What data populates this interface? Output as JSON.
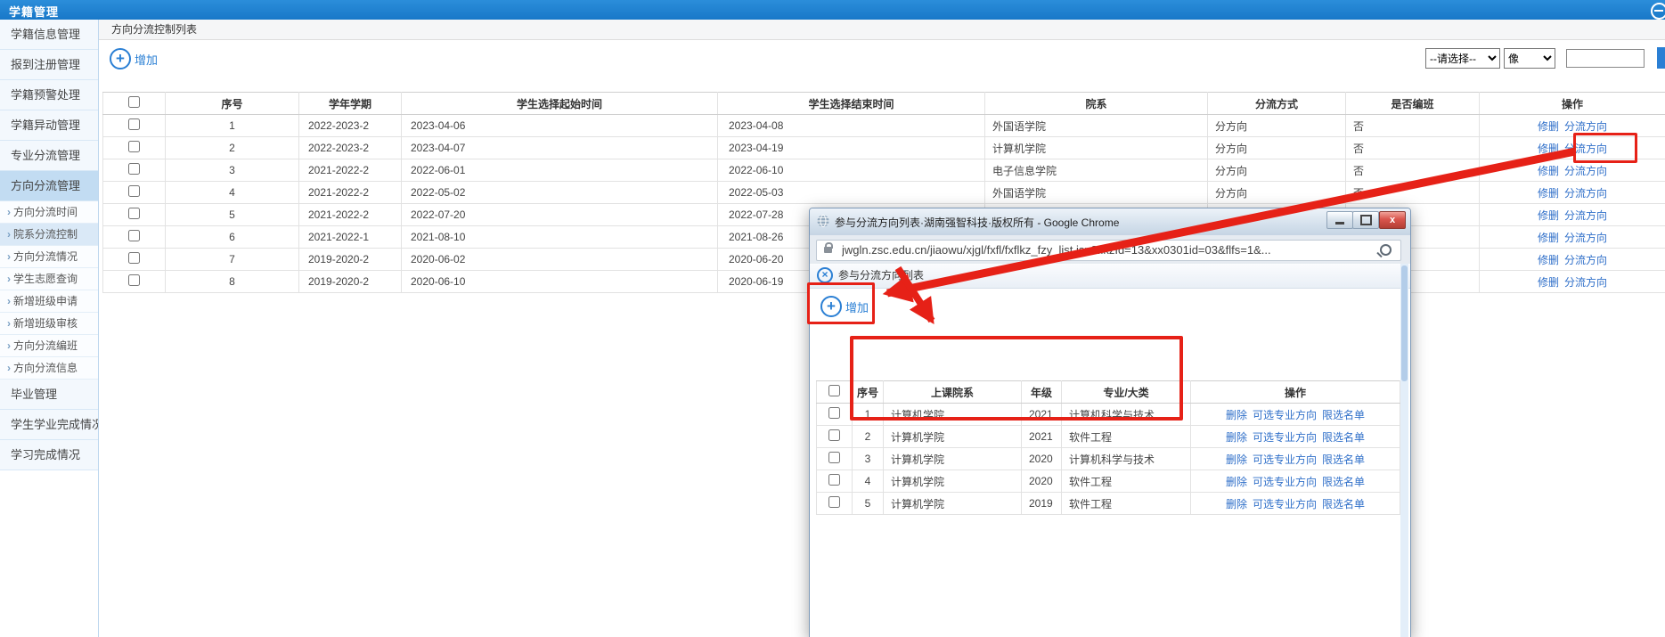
{
  "topbar": {
    "title": "学籍管理"
  },
  "sidebar": {
    "items": [
      {
        "label": "学籍信息管理",
        "type": "main",
        "active": false
      },
      {
        "label": "报到注册管理",
        "type": "main",
        "active": false
      },
      {
        "label": "学籍预警处理",
        "type": "main",
        "active": false
      },
      {
        "label": "学籍异动管理",
        "type": "main",
        "active": false
      },
      {
        "label": "专业分流管理",
        "type": "main",
        "active": false
      },
      {
        "label": "方向分流管理",
        "type": "main",
        "active": true
      },
      {
        "label": "方向分流时间",
        "type": "sub",
        "active": false
      },
      {
        "label": "院系分流控制",
        "type": "sub",
        "active": true
      },
      {
        "label": "方向分流情况",
        "type": "sub",
        "active": false
      },
      {
        "label": "学生志愿查询",
        "type": "sub",
        "active": false
      },
      {
        "label": "新增班级申请",
        "type": "sub",
        "active": false
      },
      {
        "label": "新增班级审核",
        "type": "sub",
        "active": false
      },
      {
        "label": "方向分流编班",
        "type": "sub",
        "active": false
      },
      {
        "label": "方向分流信息",
        "type": "sub",
        "active": false
      },
      {
        "label": "毕业管理",
        "type": "main",
        "active": false
      },
      {
        "label": "学生学业完成情况",
        "type": "main",
        "active": false
      },
      {
        "label": "学习完成情况",
        "type": "main",
        "active": false
      }
    ]
  },
  "content": {
    "page_title": "方向分流控制列表",
    "add_button": "增加",
    "filter": {
      "category_select": "--请选择--",
      "match_select": "像",
      "keyword_value": ""
    },
    "table": {
      "headers": [
        "序号",
        "学年学期",
        "学生选择起始时间",
        "学生选择结束时间",
        "院系",
        "分流方式",
        "是否编班",
        "操作"
      ],
      "row_actions": [
        "修删",
        "分流方向"
      ],
      "rows": [
        {
          "seq": "1",
          "term": "2022-2023-2",
          "start": "2023-04-06",
          "end": "2023-04-08",
          "dept": "外国语学院",
          "mode": "分方向",
          "classed": "否"
        },
        {
          "seq": "2",
          "term": "2022-2023-2",
          "start": "2023-04-07",
          "end": "2023-04-19",
          "dept": "计算机学院",
          "mode": "分方向",
          "classed": "否"
        },
        {
          "seq": "3",
          "term": "2021-2022-2",
          "start": "2022-06-01",
          "end": "2022-06-10",
          "dept": "电子信息学院",
          "mode": "分方向",
          "classed": "否"
        },
        {
          "seq": "4",
          "term": "2021-2022-2",
          "start": "2022-05-02",
          "end": "2022-05-03",
          "dept": "外国语学院",
          "mode": "分方向",
          "classed": "否"
        },
        {
          "seq": "5",
          "term": "2021-2022-2",
          "start": "2022-07-20",
          "end": "2022-07-28",
          "dept": "",
          "mode": "",
          "classed": ""
        },
        {
          "seq": "6",
          "term": "2021-2022-1",
          "start": "2021-08-10",
          "end": "2021-08-26",
          "dept": "",
          "mode": "",
          "classed": ""
        },
        {
          "seq": "7",
          "term": "2019-2020-2",
          "start": "2020-06-02",
          "end": "2020-06-20",
          "dept": "",
          "mode": "",
          "classed": ""
        },
        {
          "seq": "8",
          "term": "2019-2020-2",
          "start": "2020-06-10",
          "end": "2020-06-19",
          "dept": "",
          "mode": "",
          "classed": ""
        }
      ]
    }
  },
  "popup": {
    "window_title": "参与分流方向列表·湖南强智科技·版权所有 - Google Chrome",
    "url": "jwgln.zsc.edu.cn/jiaowu/xjgl/fxfl/fxflkz_fzy_list.jsp?flkzId=13&xx0301id=03&flfs=1&...",
    "page_header": "参与分流方向列表",
    "add_button": "增加",
    "table": {
      "headers": [
        "序号",
        "上课院系",
        "年级",
        "专业/大类",
        "操作"
      ],
      "row_actions": [
        "删除",
        "可选专业方向",
        "限选名单"
      ],
      "rows": [
        {
          "seq": "1",
          "dept": "计算机学院",
          "grade": "2021",
          "major": "计算机科学与技术"
        },
        {
          "seq": "2",
          "dept": "计算机学院",
          "grade": "2021",
          "major": "软件工程"
        },
        {
          "seq": "3",
          "dept": "计算机学院",
          "grade": "2020",
          "major": "计算机科学与技术"
        },
        {
          "seq": "4",
          "dept": "计算机学院",
          "grade": "2020",
          "major": "软件工程"
        },
        {
          "seq": "5",
          "dept": "计算机学院",
          "grade": "2019",
          "major": "软件工程"
        }
      ]
    }
  },
  "colors": {
    "accent_blue": "#2a7fd4",
    "link_blue": "#2f6fc9",
    "annotation_red": "#e62117"
  }
}
